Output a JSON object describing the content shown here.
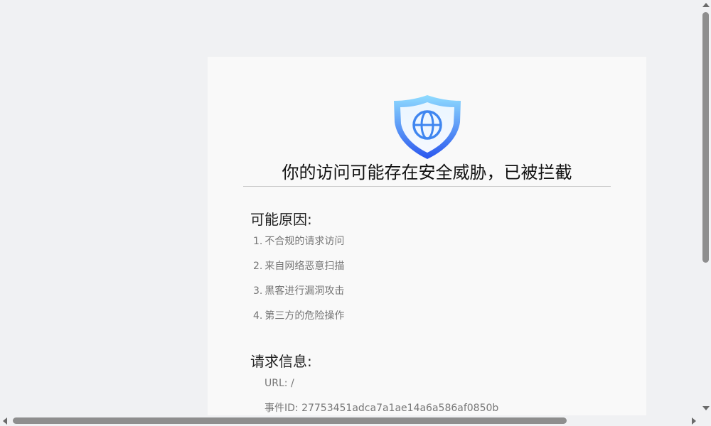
{
  "headline": "你的访问可能存在安全威胁，已被拦截",
  "reasons": {
    "title": "可能原因:",
    "items": [
      {
        "num": "1.",
        "text": "不合规的请求访问"
      },
      {
        "num": "2.",
        "text": "来自网络恶意扫描"
      },
      {
        "num": "3.",
        "text": "黑客进行漏洞攻击"
      },
      {
        "num": "4.",
        "text": "第三方的危险操作"
      }
    ]
  },
  "request_info": {
    "title": "请求信息:",
    "url": "URL: /",
    "event_id": "事件ID: 27753451adca7a1ae14a6a586af0850b"
  },
  "icons": {
    "shield": "shield-globe-icon"
  },
  "colors": {
    "shield_top": "#7ed4fb",
    "shield_bottom": "#2f5ff0",
    "text_muted": "#777777"
  }
}
